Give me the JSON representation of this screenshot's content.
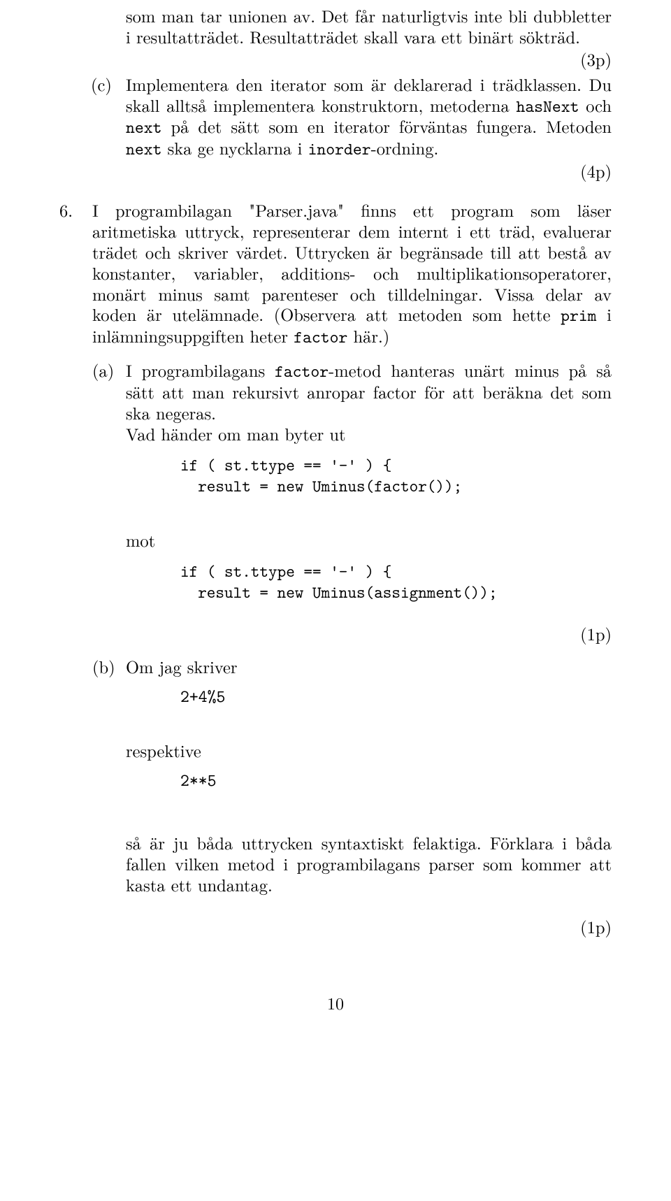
{
  "para_top": "som man tar unionen av. Det får naturligtvis inte bli dubbletter i resultatträdet. Resultatträdet skall vara ett binärt sökträd.",
  "points_3p": "(3p)",
  "c_label": "(c)",
  "c_text_1": "Implementera den iterator som är deklarerad i trädklassen. Du skall alltså implementera konstruktorn, metoderna ",
  "c_code_hasNext": "hasNext",
  "c_text_2": " och ",
  "c_code_next1": "next",
  "c_text_3": " på det sätt som en iterator förväntas fungera. Metoden ",
  "c_code_next2": "next",
  "c_text_4": " ska ge nycklarna i ",
  "c_code_inorder": "inorder",
  "c_text_5": "-ordning.",
  "points_4p": "(4p)",
  "item6_num": "6.",
  "item6_text_1": "I programbilagan \"Parser.java\" finns ett program som läser aritmetiska uttryck, representerar dem internt i ett träd, evaluerar trädet och skriver värdet. Uttrycken är begränsade till att bestå av konstanter, variabler, additions- och multiplikationsoperatorer, monärt minus samt parenteser och tilldelningar. Vissa delar av koden är utelämnade. (Observera att metoden som hette ",
  "item6_code_prim": "prim",
  "item6_text_2": " i inlämningsuppgiften heter ",
  "item6_code_factor": "factor",
  "item6_text_3": " här.)",
  "a_label": "(a)",
  "a_text_1": "I programbilagans ",
  "a_code_factor": "factor",
  "a_text_2": "-metod hanteras unärt minus på så sätt att man rekursivt anropar factor för att beräkna det som ska negeras.",
  "a_text_3": "Vad händer om man byter ut",
  "codeblock1": "if ( st.ttype == '-' ) {\n  result = new Uminus(factor());",
  "mot": "mot",
  "codeblock2": "if ( st.ttype == '-' ) {\n  result = new Uminus(assignment());",
  "points_1p_a": "(1p)",
  "b_label": "(b)",
  "b_text": "Om jag skriver",
  "b_code1": "2+4%5",
  "respektive": "respektive",
  "b_code2": "2**5",
  "b_conclusion": "så är ju båda uttrycken syntaxtiskt felaktiga. Förklara i båda fallen vilken metod i programbilagans parser som kommer att kasta ett undantag.",
  "points_1p_b": "(1p)",
  "pagenum": "10"
}
